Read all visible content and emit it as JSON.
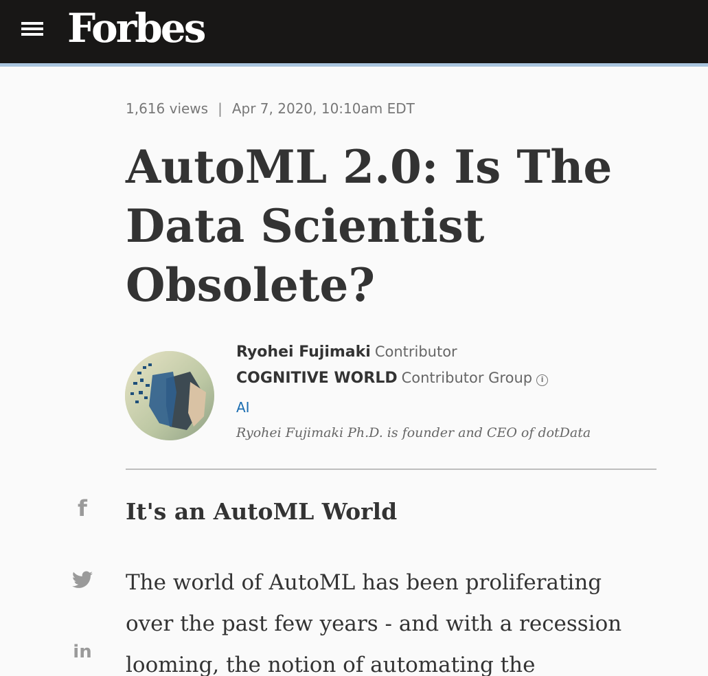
{
  "header": {
    "logo": "Forbes",
    "menu_icon": "hamburger-menu-icon"
  },
  "article": {
    "views": "1,616 views",
    "separator": "|",
    "date": "Apr 7, 2020, 10:10am EDT",
    "headline": "AutoML 2.0: Is The Data Scientist Obsolete?",
    "author": {
      "name": "Ryohei Fujimaki",
      "role": "Contributor",
      "group": "COGNITIVE WORLD",
      "group_role": "Contributor Group",
      "topic": "AI",
      "bio": "Ryohei Fujimaki Ph.D. is founder and CEO of dotData"
    },
    "subhead": "It's an AutoML World",
    "body": "The world of AutoML has been proliferating over the past few years - and with a recession looming, the notion of automating the"
  },
  "share": {
    "facebook": "f",
    "linkedin": "in",
    "twitter_icon": "twitter-bird-icon"
  },
  "colors": {
    "header_bg": "#181716",
    "header_accent": "#a9c4dd",
    "link": "#1a6db1"
  }
}
